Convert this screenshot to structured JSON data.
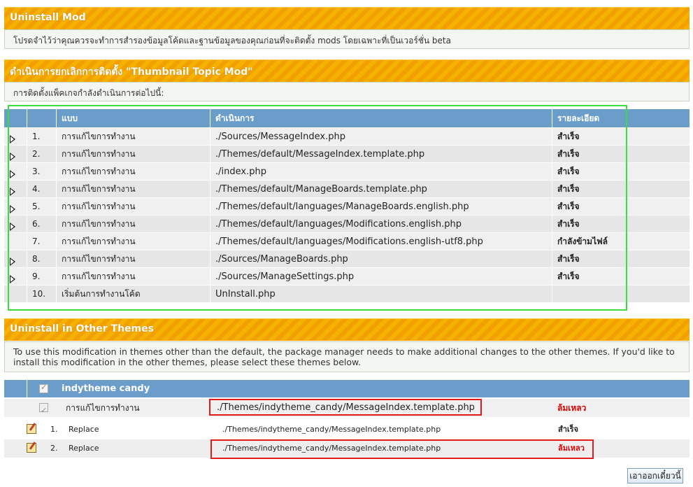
{
  "uninstall_header": "Uninstall Mod",
  "backup_warning": "โปรดจำไว้ว่าคุณควรจะทำการสำรองข้อมูลโค้ดและฐานข้อมูลของคุณก่อนที่จะติดตั้ง mods โดยเฉพาะที่เป็นเวอร์ชั่น beta",
  "action_header": "ดำเนินการยกเลิกการติดตั้ง \"Thumbnail Topic Mod\"",
  "action_note": "การติดตั้งแพ็คเกจกำลังดำเนินการต่อไปนี้:",
  "table": {
    "columns": {
      "type": "แบบ",
      "action": "ดำเนินการ",
      "result": "รายละเอียด"
    },
    "rows": [
      {
        "num": "1.",
        "type": "การแก้ไขการทำงาน",
        "action": "./Sources/MessageIndex.php",
        "result": "สำเร็จ"
      },
      {
        "num": "2.",
        "type": "การแก้ไขการทำงาน",
        "action": "./Themes/default/MessageIndex.template.php",
        "result": "สำเร็จ"
      },
      {
        "num": "3.",
        "type": "การแก้ไขการทำงาน",
        "action": "./index.php",
        "result": "สำเร็จ"
      },
      {
        "num": "4.",
        "type": "การแก้ไขการทำงาน",
        "action": "./Themes/default/ManageBoards.template.php",
        "result": "สำเร็จ"
      },
      {
        "num": "5.",
        "type": "การแก้ไขการทำงาน",
        "action": "./Themes/default/languages/ManageBoards.english.php",
        "result": "สำเร็จ"
      },
      {
        "num": "6.",
        "type": "การแก้ไขการทำงาน",
        "action": "./Themes/default/languages/Modifications.english.php",
        "result": "สำเร็จ"
      },
      {
        "num": "7.",
        "type": "การแก้ไขการทำงาน",
        "action": "./Themes/default/languages/Modifications.english-utf8.php",
        "result": "กำลังข้ามไฟล์"
      },
      {
        "num": "8.",
        "type": "การแก้ไขการทำงาน",
        "action": "./Sources/ManageBoards.php",
        "result": "สำเร็จ"
      },
      {
        "num": "9.",
        "type": "การแก้ไขการทำงาน",
        "action": "./Sources/ManageSettings.php",
        "result": "สำเร็จ"
      },
      {
        "num": "10.",
        "type": "เริ่มต้นการทำงานโค้ด",
        "action": "UnInstall.php",
        "result": ""
      }
    ]
  },
  "other_themes_header": "Uninstall in Other Themes",
  "other_themes_note": "To use this modification in themes other than the default, the package manager needs to make additional changes to the other themes. If you'd like to install this modification in the other themes, please select these themes below.",
  "theme": {
    "name": "indytheme candy",
    "summary": {
      "type": "การแก้ไขการทำงาน",
      "file": "./Themes/indytheme_candy/MessageIndex.template.php",
      "result": "ล้มเหลว"
    },
    "steps": [
      {
        "num": "1.",
        "type": "Replace",
        "file": "./Themes/indytheme_candy/MessageIndex.template.php",
        "result": "สำเร็จ"
      },
      {
        "num": "2.",
        "type": "Replace",
        "file": "./Themes/indytheme_candy/MessageIndex.template.php",
        "result": "ล้มเหลว"
      }
    ]
  },
  "submit_label": "เอาออกเดี๋ยวนี้"
}
